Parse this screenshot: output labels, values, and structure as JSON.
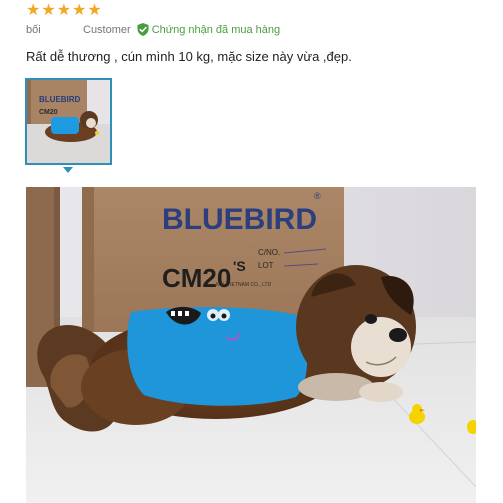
{
  "rating": {
    "value": 5,
    "max": 5,
    "star_glyph": "★",
    "color": "#f5a623"
  },
  "review": {
    "author": "bối",
    "role": "Customer",
    "verified_label": "Chứng nhận đã mua hàng",
    "text": "Rất dễ thương , cún mình 10 kg, mặc size này vừa ,đẹp."
  },
  "photo": {
    "box_brand": "BLUEBIRD",
    "box_reg": "®",
    "box_model": "CM20",
    "box_model_sup": "'S",
    "box_cno": "C/NO.",
    "box_lot": "LOT",
    "box_footer": "K.B. VIETNAM CO., LTD",
    "thumb_brand": "BLUEBIRD",
    "thumb_model": "CM20"
  },
  "colors": {
    "accent": "#2f8fb6",
    "verified": "#4a9d3f"
  }
}
